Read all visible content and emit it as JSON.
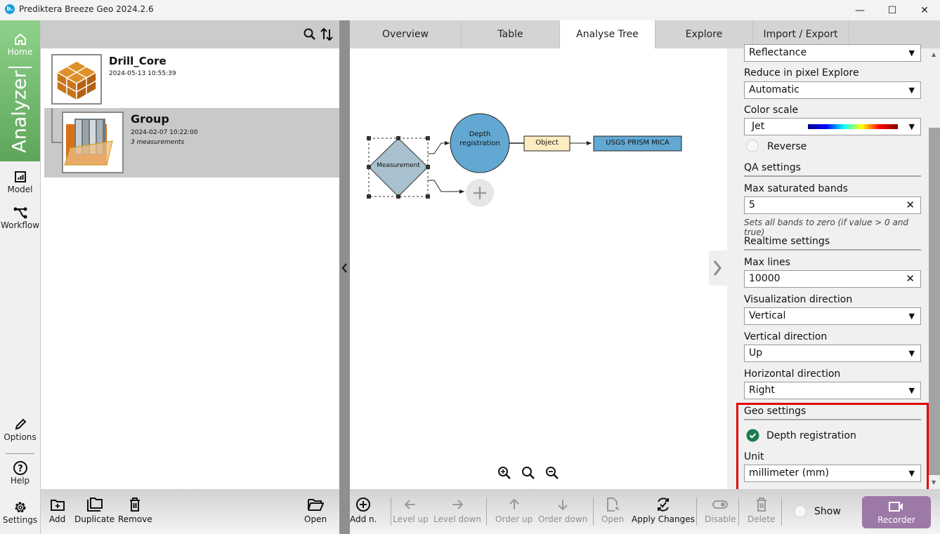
{
  "window": {
    "title": "Prediktera Breeze Geo 2024.2.6",
    "logo_text": "b.",
    "controls": {
      "minimize": "—",
      "maximize": "☐",
      "close": "✕"
    }
  },
  "nav": {
    "home": "Home",
    "analyzer": "Analyzer",
    "model": "Model",
    "workflow": "Workflow",
    "options": "Options",
    "help": "Help",
    "settings": "Settings"
  },
  "tree": {
    "items": [
      {
        "title": "Drill_Core",
        "date": "2024-05-13 10:55:39",
        "sub": ""
      },
      {
        "title": "Group",
        "date": "2024-02-07 10:22:00",
        "sub": "3 measurements"
      }
    ]
  },
  "tabs": [
    "Overview",
    "Table",
    "Analyse Tree",
    "Explore",
    "Import / Export"
  ],
  "active_tab": "Analyse Tree",
  "diagram": {
    "nodes": {
      "measurement": "Measurement",
      "depth_line1": "Depth",
      "depth_line2": "registration",
      "object": "Object",
      "model": "USGS PRISM MICA"
    },
    "colors": {
      "measurement": "#a9c1cf",
      "depth": "#62a8d3",
      "object": "#fdebc1",
      "model": "#62a8d3"
    }
  },
  "settings": {
    "data_type_value": "Reflectance",
    "reduce_label": "Reduce in pixel Explore",
    "reduce_value": "Automatic",
    "color_scale_label": "Color scale",
    "color_scale_value": "Jet",
    "reverse_label": "Reverse",
    "qa_heading": "QA settings",
    "max_sat_label": "Max saturated bands",
    "max_sat_value": "5",
    "max_sat_hint": "Sets all bands to zero (if value > 0 and true)",
    "realtime_heading": "Realtime settings",
    "max_lines_label": "Max lines",
    "max_lines_value": "10000",
    "vis_dir_label": "Visualization direction",
    "vis_dir_value": "Vertical",
    "vert_dir_label": "Vertical direction",
    "vert_dir_value": "Up",
    "horiz_dir_label": "Horizontal direction",
    "horiz_dir_value": "Right",
    "geo_heading": "Geo settings",
    "depth_reg_label": "Depth registration",
    "depth_reg_checked": true,
    "unit_label": "Unit",
    "unit_value": "millimeter (mm)"
  },
  "left_toolbar": {
    "add": "Add",
    "duplicate": "Duplicate",
    "remove": "Remove",
    "open": "Open"
  },
  "main_toolbar": {
    "add_node": "Add n.",
    "level_up": "Level up",
    "level_down": "Level down",
    "order_up": "Order up",
    "order_down": "Order down",
    "open": "Open",
    "apply_changes": "Apply Changes",
    "disable": "Disable",
    "delete": "Delete",
    "show": "Show",
    "recorder": "Recorder"
  },
  "colors": {
    "nav_green": "#6bb167",
    "recorder": "#9d79a8",
    "highlight": "#e00000",
    "check": "#1e7a52"
  }
}
